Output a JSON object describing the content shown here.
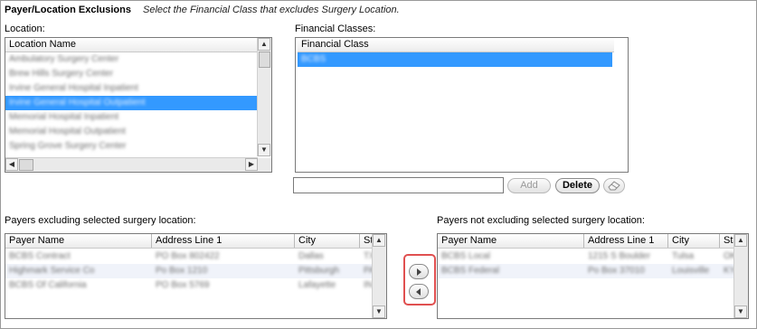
{
  "header": {
    "title": "Payer/Location Exclusions",
    "instruction": "Select the Financial Class that excludes Surgery Location."
  },
  "location": {
    "label": "Location:",
    "column": "Location Name",
    "items": [
      {
        "name": "Ambulatory Surgery Center",
        "selected": false
      },
      {
        "name": "Brew Hills Surgery Center",
        "selected": false
      },
      {
        "name": "Irvine General Hospital Inpatient",
        "selected": false
      },
      {
        "name": "Irvine General Hospital Outpatient",
        "selected": true
      },
      {
        "name": "Memorial Hospital Inpatient",
        "selected": false
      },
      {
        "name": "Memorial Hospital Outpatient",
        "selected": false
      },
      {
        "name": "Spring Grove Surgery Center",
        "selected": false
      }
    ]
  },
  "financial_classes": {
    "label": "Financial Classes:",
    "column": "Financial Class",
    "items": [
      {
        "name": "BCBS",
        "selected": true
      }
    ],
    "input_value": "",
    "add_label": "Add",
    "delete_label": "Delete"
  },
  "payers_excluding": {
    "label": "Payers excluding selected surgery location:",
    "columns": [
      "Payer Name",
      "Address Line 1",
      "City",
      "State"
    ],
    "rows": [
      [
        "BCBS Contract",
        "PO Box 802422",
        "Dallas",
        "TX"
      ],
      [
        "Highmark Service Co",
        "Po Box 1210",
        "Pittsburgh",
        "PA"
      ],
      [
        "BCBS Of California",
        "PO Box 5769",
        "Lafayette",
        "IN"
      ]
    ]
  },
  "payers_not_excluding": {
    "label": "Payers not excluding selected surgery location:",
    "columns": [
      "Payer Name",
      "Address Line 1",
      "City",
      "State"
    ],
    "rows": [
      [
        "BCBS Local",
        "1215 S Boulder",
        "Tulsa",
        "OK"
      ],
      [
        "BCBS Federal",
        "Po Box 37010",
        "Louisville",
        "KY"
      ]
    ]
  },
  "colors": {
    "selection": "#3399ff",
    "highlight_box": "#e05050"
  }
}
